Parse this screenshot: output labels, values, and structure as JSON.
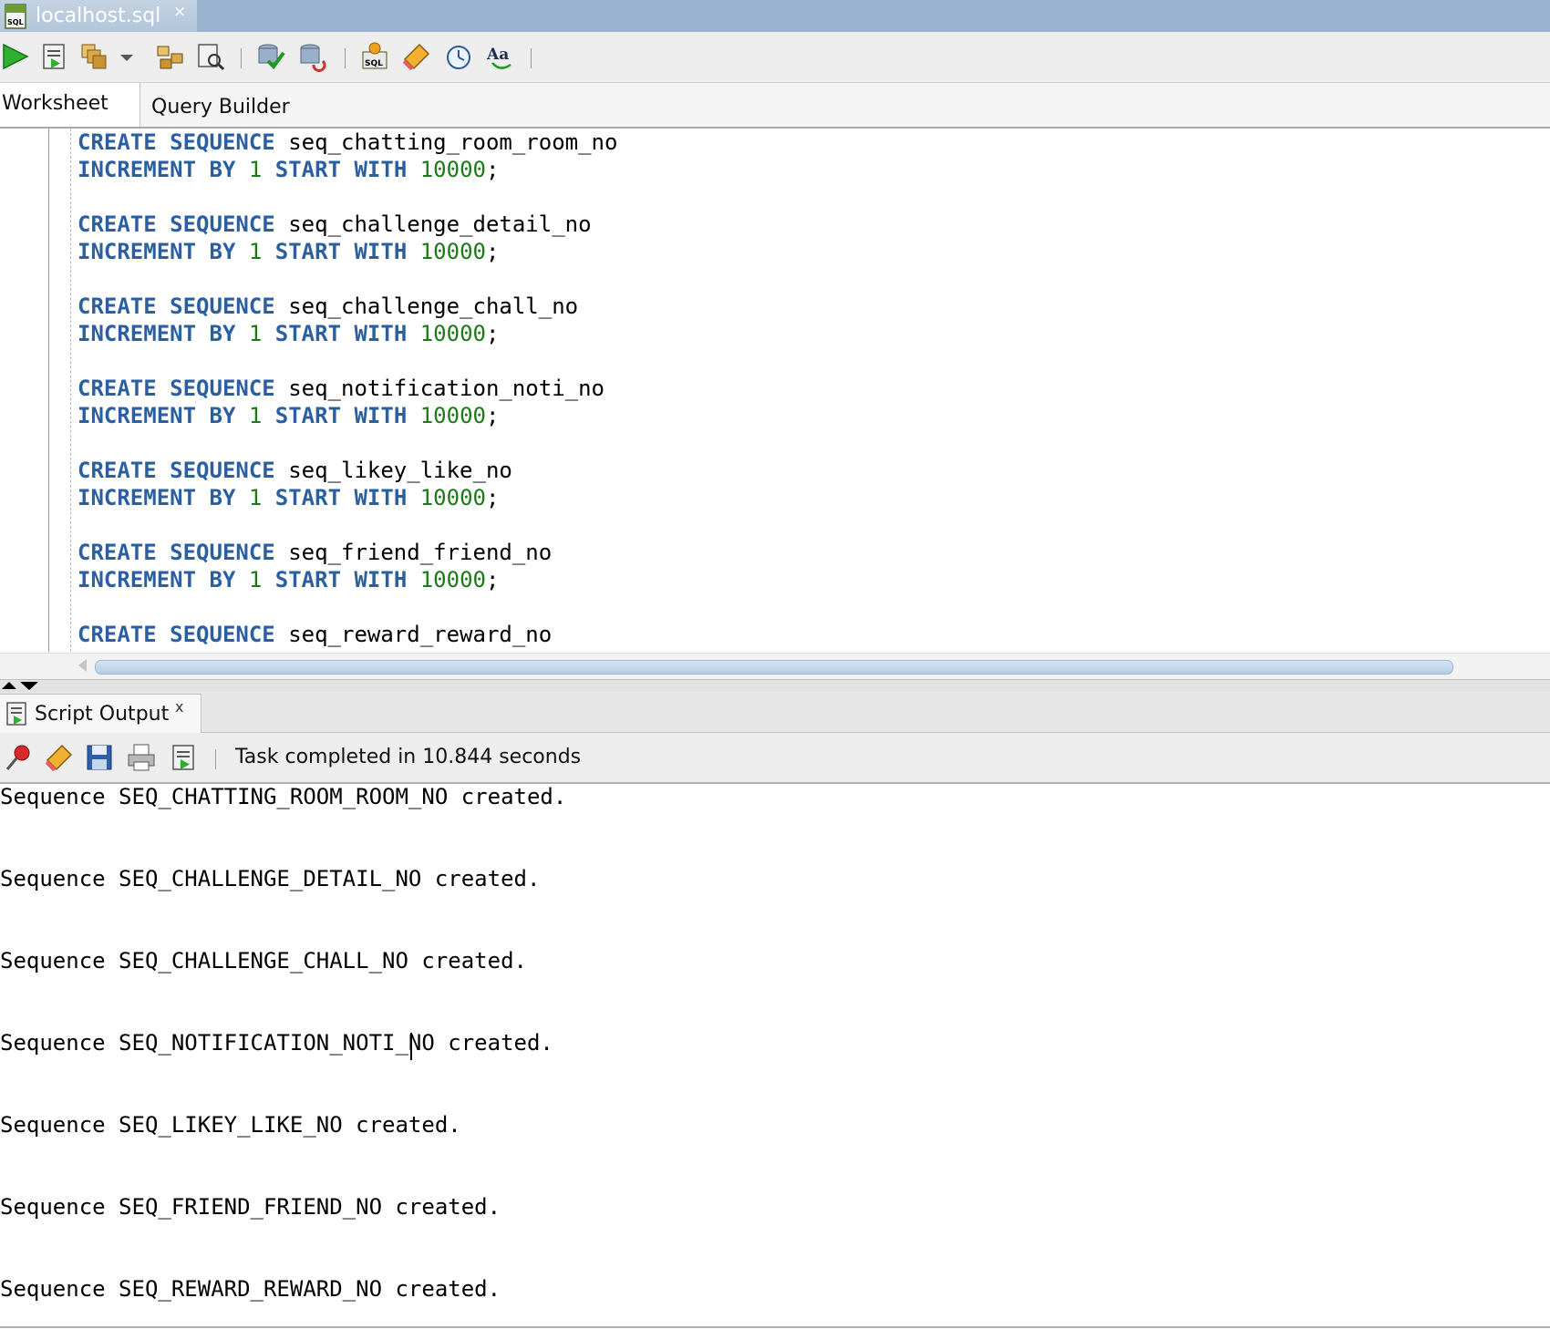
{
  "document_tab": {
    "title": "localhost.sql",
    "close_glyph": "×"
  },
  "toolbar": {
    "buttons": [
      "run-statement-icon",
      "run-script-icon",
      "commit-icon",
      "dropdown-arrow-icon",
      "explain-plan-icon",
      "autotrace-icon",
      "commit-check-icon",
      "rollback-icon",
      "sql-tuning-icon",
      "clear-eraser-icon",
      "history-clock-icon",
      "format-text-icon"
    ]
  },
  "worksheet_tabs": {
    "worksheet": "Worksheet",
    "query_builder": "Query Builder"
  },
  "editor": {
    "keywords": {
      "create": "CREATE",
      "sequence": "SEQUENCE",
      "increment": "INCREMENT",
      "by": "BY",
      "start": "START",
      "with": "WITH"
    },
    "increment_value": "1",
    "start_value": "10000",
    "terminator": ";",
    "sequences": [
      "seq_chatting_room_room_no",
      "seq_challenge_detail_no",
      "seq_challenge_chall_no",
      "seq_notification_noti_no",
      "seq_likey_like_no",
      "seq_friend_friend_no",
      "seq_reward_reward_no"
    ]
  },
  "output_panel": {
    "tab_title": "Script Output",
    "close_glyph": "x",
    "status": "Task completed in 10.844 seconds",
    "lines": [
      "Sequence SEQ_CHATTING_ROOM_ROOM_NO created.",
      "Sequence SEQ_CHALLENGE_DETAIL_NO created.",
      "Sequence SEQ_CHALLENGE_CHALL_NO created.",
      "Sequence SEQ_NOTIFICATION_NOTI_NO created.",
      "Sequence SEQ_LIKEY_LIKE_NO created.",
      "Sequence SEQ_FRIEND_FRIEND_NO created.",
      "Sequence SEQ_REWARD_REWARD_NO created."
    ]
  },
  "colors": {
    "keyword": "#2b5fa0",
    "number": "#1d7a18",
    "tab_strip": "#9ab3cf"
  }
}
